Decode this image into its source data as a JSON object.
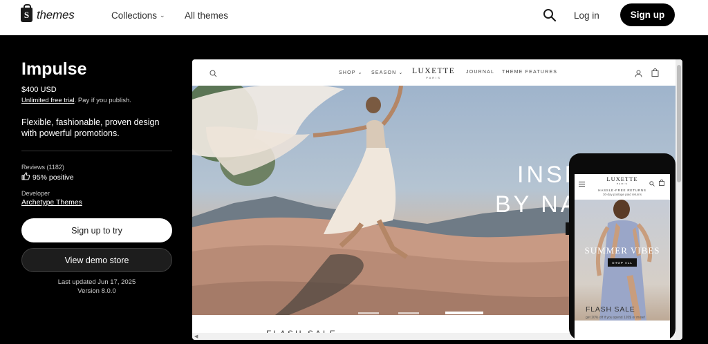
{
  "topnav": {
    "logo_text": "themes",
    "collections": "Collections",
    "all_themes": "All themes",
    "login": "Log in",
    "signup": "Sign up"
  },
  "theme": {
    "name": "Impulse",
    "price": "$400 USD",
    "trial_link": "Unlimited free trial",
    "trial_note": ". Pay if you publish.",
    "description": "Flexible, fashionable, proven design with powerful promotions.",
    "reviews_label": "Reviews (1182)",
    "reviews_value": "95% positive",
    "developer_label": "Developer",
    "developer_name": "Archetype Themes",
    "signup_try": "Sign up to try",
    "view_demo": "View demo store",
    "last_updated": "Last updated Jun 17, 2025",
    "version": "Version 8.0.0"
  },
  "preview": {
    "nav_shop": "SHOP",
    "nav_season": "SEASON",
    "brand": "LUXETTE",
    "brand_sub": "PARIS",
    "nav_journal": "JOURNAL",
    "nav_features": "THEME FEATURES",
    "hero_line1": "INSF",
    "hero_line2": "BY NA",
    "flash_peek": "FLASH SALE"
  },
  "phone": {
    "brand": "LUXETTE",
    "brand_sub": "PARIS",
    "promo_title": "HASSLE-FREE RETURNS",
    "promo_sub": "30-day postage paid returns",
    "hero_title": "SUMMER VIBES",
    "shop_all": "SHOP ALL",
    "flash_title": "FLASH SALE",
    "flash_sub": "get 20% off if you spend 120$ or more!"
  },
  "colors": {
    "page_bg": "#000000",
    "accent": "#ffffff"
  }
}
